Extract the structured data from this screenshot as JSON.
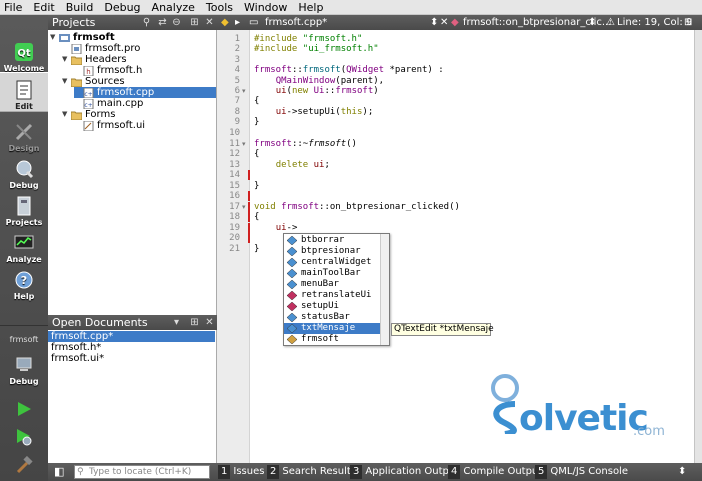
{
  "menubar": [
    "File",
    "Edit",
    "Build",
    "Debug",
    "Analyze",
    "Tools",
    "Window",
    "Help"
  ],
  "modes": {
    "welcome": "Welcome",
    "edit": "Edit",
    "design": "Design",
    "debug": "Debug",
    "projects": "Projects",
    "analyze": "Analyze",
    "help": "Help"
  },
  "target": {
    "project": "frmsoft",
    "config": "Debug"
  },
  "projects_pane": {
    "title": "Projects",
    "tree": [
      {
        "label": "frmsoft",
        "bold": true
      },
      {
        "label": "frmsoft.pro"
      },
      {
        "label": "Headers"
      },
      {
        "label": "frmsoft.h"
      },
      {
        "label": "Sources"
      },
      {
        "label": "frmsoft.cpp",
        "selected": true
      },
      {
        "label": "main.cpp"
      },
      {
        "label": "Forms"
      },
      {
        "label": "frmsoft.ui"
      }
    ]
  },
  "open_documents": {
    "title": "Open Documents",
    "items": [
      "frmsoft.cpp*",
      "frmsoft.h*",
      "frmsoft.ui*"
    ]
  },
  "editor_toolbar": {
    "file": "frmsoft.cpp*",
    "symbol": "frmsoft::on_btpresionar_clic...",
    "position": "Line: 19, Col: 9"
  },
  "line_numbers": [
    "1",
    "2",
    "3",
    "4",
    "5",
    "6",
    "7",
    "8",
    "9",
    "10",
    "11",
    "12",
    "13",
    "14",
    "15",
    "16",
    "17",
    "18",
    "19",
    "20",
    "21"
  ],
  "completion": {
    "items": [
      "btborrar",
      "btpresionar",
      "centralWidget",
      "mainToolBar",
      "menuBar",
      "retranslateUi",
      "setupUi",
      "statusBar",
      "txtMensaje",
      "frmsoft"
    ],
    "selected_index": 8,
    "tooltip": "QTextEdit *txtMensaje"
  },
  "watermark": {
    "text": "olvetic",
    "domain": ".com"
  },
  "statusbar": {
    "locate_placeholder": "Type to locate (Ctrl+K)",
    "panes": [
      {
        "num": "1",
        "label": "Issues"
      },
      {
        "num": "2",
        "label": "Search Results"
      },
      {
        "num": "3",
        "label": "Application Output"
      },
      {
        "num": "4",
        "label": "Compile Output"
      },
      {
        "num": "5",
        "label": "QML/JS Console"
      }
    ]
  },
  "colors": {
    "selection": "#3d7bc7",
    "keyword": "#808000",
    "string": "#008000",
    "class": "#800080",
    "change_marker": "#d02020"
  }
}
